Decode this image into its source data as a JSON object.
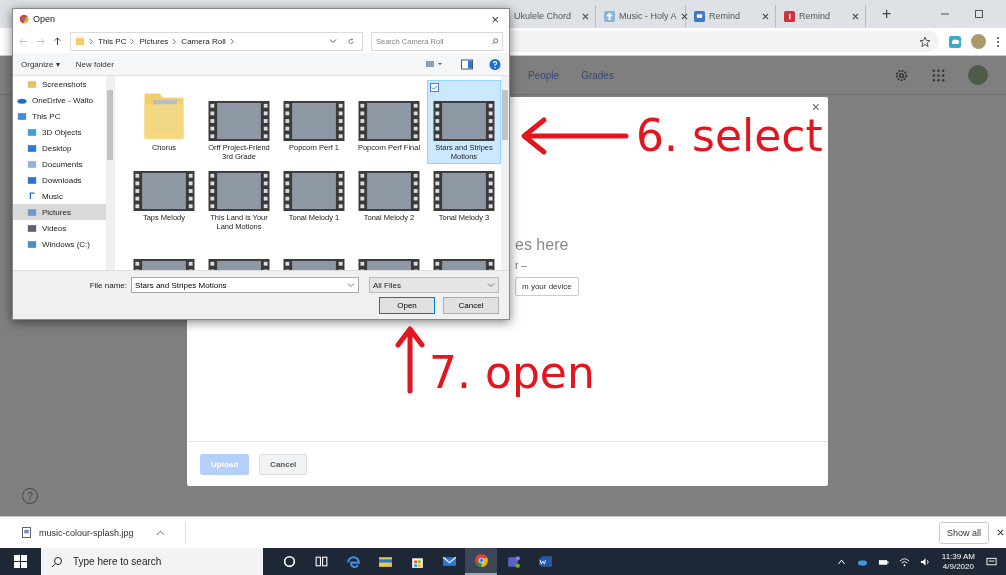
{
  "browser": {
    "tabs": [
      {
        "title": "Ukulele Chord",
        "kind": "none"
      },
      {
        "title": "Music - Holy A",
        "kind": "cross"
      },
      {
        "title": "Remind",
        "kind": "chat"
      },
      {
        "title": "Remind",
        "kind": "badge"
      }
    ],
    "new_tab": "+",
    "page": {
      "nav": [
        "People",
        "Grades"
      ],
      "help": "?"
    }
  },
  "upload_dialog": {
    "close": "×",
    "drop_text": "es here",
    "or_text": "r –",
    "device_button": "m your device",
    "buttons": [
      {
        "label": "Upload",
        "disabled": true
      },
      {
        "label": "Cancel",
        "disabled": false
      }
    ]
  },
  "open_dialog": {
    "title": "Open",
    "close": "×",
    "path": [
      "This PC",
      "Pictures",
      "Camera Roll"
    ],
    "search": {
      "placeholder": "Search Camera Roll"
    },
    "toolbar": {
      "organize": "Organize ▾",
      "new_folder": "New folder"
    },
    "nav": [
      {
        "children": [
          {
            "label": "Screenshots",
            "kind": "folder",
            "selected": false
          }
        ]
      },
      {
        "label": "OneDrive - Walto",
        "kind": "cloud",
        "selected": false
      },
      {
        "label": "This PC",
        "kind": "computer",
        "selected": false,
        "children": [
          {
            "label": "3D Objects",
            "kind": "cube",
            "selected": false
          },
          {
            "label": "Desktop",
            "kind": "desktop",
            "selected": false
          },
          {
            "label": "Documents",
            "kind": "document",
            "selected": false
          },
          {
            "label": "Downloads",
            "kind": "download",
            "selected": false
          },
          {
            "label": "Music",
            "kind": "music",
            "selected": false
          },
          {
            "label": "Pictures",
            "kind": "pictures",
            "selected": true
          },
          {
            "label": "Videos",
            "kind": "videos",
            "selected": false
          },
          {
            "label": "Windows (C:)",
            "kind": "drive",
            "selected": false
          }
        ]
      }
    ],
    "files": [
      {
        "name": "Chorus",
        "kind": "folder",
        "selected": false
      },
      {
        "name": "Orff Project-Friend 3rd Grade",
        "kind": "video",
        "selected": false
      },
      {
        "name": "Popcorn Perf 1",
        "kind": "video",
        "selected": false
      },
      {
        "name": "Popcorn Perf Final",
        "kind": "video",
        "selected": false
      },
      {
        "name": "Stars and Stripes Motions",
        "kind": "video",
        "selected": true
      },
      {
        "name": "Taps Melody",
        "kind": "video",
        "selected": false
      },
      {
        "name": "This Land is Your Land Motions",
        "kind": "video",
        "selected": false
      },
      {
        "name": "Tonal Melody 1",
        "kind": "video",
        "selected": false
      },
      {
        "name": "Tonal Melody 2",
        "kind": "video",
        "selected": false
      },
      {
        "name": "Tonal Melody 3",
        "kind": "video",
        "selected": false
      },
      {
        "kind": "video",
        "selected": false
      },
      {
        "kind": "video",
        "selected": false
      },
      {
        "kind": "video",
        "selected": false
      },
      {
        "kind": "video",
        "selected": false
      },
      {
        "kind": "video",
        "selected": false
      }
    ],
    "file_name": {
      "label": "File name:",
      "value": "Stars and Stripes Motions"
    },
    "filter": "All Files",
    "buttons": [
      {
        "label": "Open",
        "default": true
      },
      {
        "label": "Cancel",
        "default": false
      }
    ]
  },
  "annotations": [
    {
      "text": "6. select",
      "kind": "left-arrow"
    },
    {
      "text": "7. open",
      "kind": "up-arrow"
    }
  ],
  "download_bar": {
    "file": "music-colour-splash.jpg",
    "show_all": "Show all"
  },
  "taskbar": {
    "search": {
      "placeholder": "Type here to search"
    },
    "apps": [
      {
        "kind": "cortana",
        "active": false
      },
      {
        "kind": "taskview",
        "active": false
      },
      {
        "kind": "edge",
        "active": false
      },
      {
        "kind": "explorer",
        "active": false
      },
      {
        "kind": "store",
        "active": false
      },
      {
        "kind": "mail",
        "active": false
      },
      {
        "kind": "chrome",
        "active": true
      },
      {
        "kind": "teams",
        "active": false
      },
      {
        "kind": "word",
        "active": false
      }
    ],
    "time": "11:39 AM",
    "date": "4/9/2020"
  }
}
